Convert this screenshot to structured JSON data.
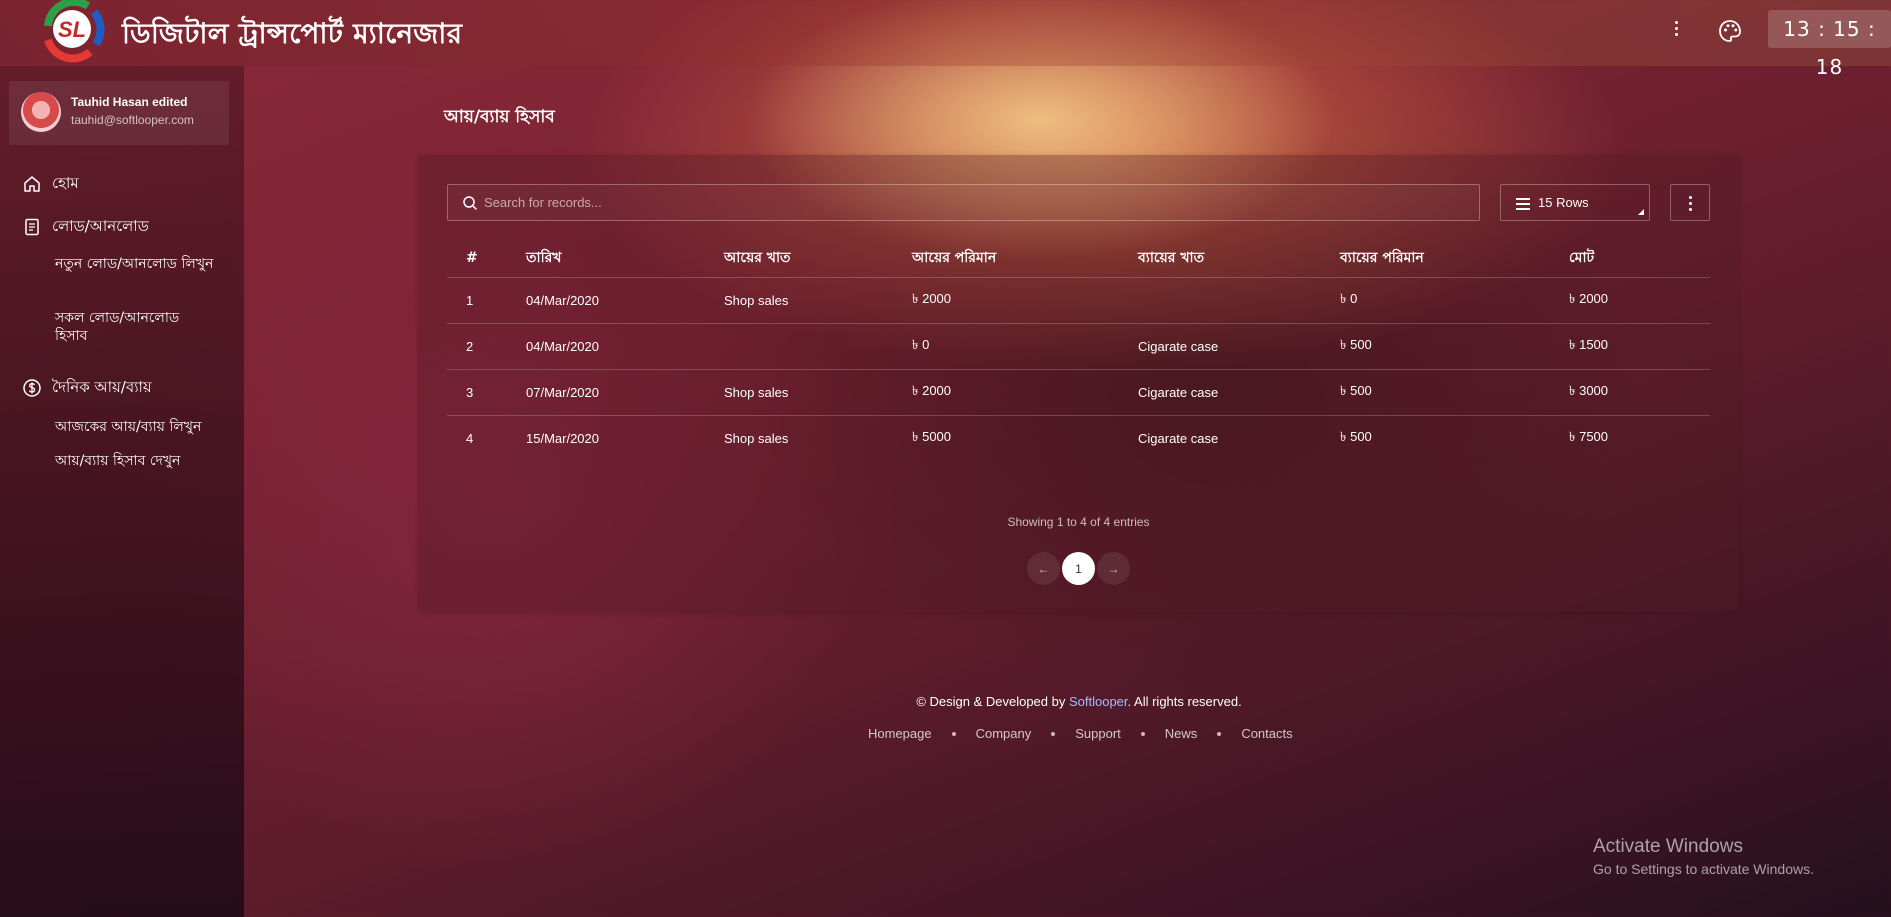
{
  "header": {
    "logo_text": "SL",
    "app_title": "ডিজিটাল ট্রান্সপোর্ট ম্যানেজার",
    "clock": "13 : 15 : 18"
  },
  "sidebar": {
    "user": {
      "name": "Tauhid Hasan edited",
      "email": "tauhid@softlooper.com"
    },
    "items": [
      {
        "label": "হোম",
        "icon": "home-icon"
      },
      {
        "label": "লোড/আনলোড",
        "icon": "document-icon"
      },
      {
        "label": "নতুন লোড/আনলোড লিখুন"
      },
      {
        "label": "সকল লোড/আনলোড হিসাব"
      },
      {
        "label": "দৈনিক আয়/ব্যায়",
        "icon": "currency-icon"
      },
      {
        "label": "আজকের আয়/ব্যায় লিখুন"
      },
      {
        "label": "আয়/ব্যায় হিসাব দেখুন"
      }
    ]
  },
  "main": {
    "page_title": "আয়/ব্যায় হিসাব",
    "search_placeholder": "Search for records...",
    "rows_label": "15 Rows",
    "columns": [
      "#",
      "তারিখ",
      "আয়ের খাত",
      "আয়ের পরিমান",
      "ব্যায়ের খাত",
      "ব্যায়ের পরিমান",
      "মোট"
    ],
    "rows": [
      [
        "1",
        "04/Mar/2020",
        "Shop sales",
        "৳ 2000",
        "",
        "৳ 0",
        "৳ 2000"
      ],
      [
        "2",
        "04/Mar/2020",
        "",
        "৳ 0",
        "Cigarate case",
        "৳ 500",
        "৳ 1500"
      ],
      [
        "3",
        "07/Mar/2020",
        "Shop sales",
        "৳ 2000",
        "Cigarate case",
        "৳ 500",
        "৳ 3000"
      ],
      [
        "4",
        "15/Mar/2020",
        "Shop sales",
        "৳ 5000",
        "Cigarate case",
        "৳ 500",
        "৳ 7500"
      ]
    ],
    "showing": "Showing 1 to 4 of 4 entries",
    "pagination": {
      "prev": "←",
      "current": "1",
      "next": "→"
    }
  },
  "footer": {
    "copy_prefix": "© Design & Developed by ",
    "brand": "Softlooper",
    "copy_suffix": ". All rights reserved.",
    "links": [
      "Homepage",
      "Company",
      "Support",
      "News",
      "Contacts"
    ]
  },
  "watermark": {
    "title": "Activate Windows",
    "subtitle": "Go to Settings to activate Windows."
  },
  "colors": {
    "brand_link": "#9cc0ff",
    "logo_red": "#e53935",
    "logo_green": "#2e9e48",
    "logo_blue": "#1e5cc6"
  }
}
